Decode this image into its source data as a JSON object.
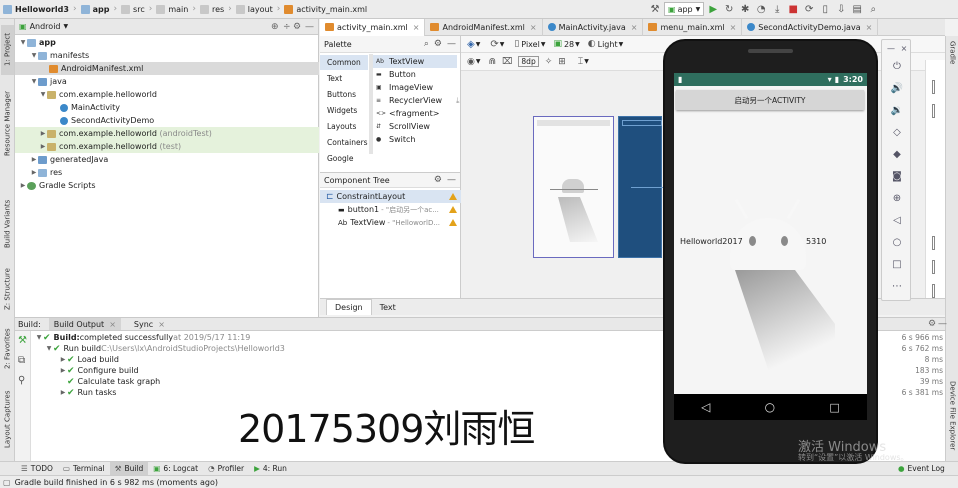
{
  "nav": {
    "crumbs": [
      "Helloworld3",
      "app",
      "src",
      "main",
      "res",
      "layout",
      "activity_main.xml"
    ],
    "run_config": "app"
  },
  "project": {
    "view_mode": "Android",
    "tree": [
      {
        "label": "app"
      },
      {
        "label": "manifests"
      },
      {
        "label": "AndroidManifest.xml"
      },
      {
        "label": "java"
      },
      {
        "label": "com.example.helloworld"
      },
      {
        "label": "MainActivity"
      },
      {
        "label": "SecondActivityDemo"
      },
      {
        "label": "com.example.helloworld",
        "suffix": "(androidTest)"
      },
      {
        "label": "com.example.helloworld",
        "suffix": "(test)"
      },
      {
        "label": "generatedJava"
      },
      {
        "label": "res"
      },
      {
        "label": "Gradle Scripts"
      }
    ]
  },
  "editor_tabs": [
    "activity_main.xml",
    "AndroidManifest.xml",
    "MainActivity.java",
    "menu_main.xml",
    "SecondActivityDemo.java"
  ],
  "palette": {
    "title": "Palette",
    "categories": [
      "Common",
      "Text",
      "Buttons",
      "Widgets",
      "Layouts",
      "Containers",
      "Google"
    ],
    "items": [
      "TextView",
      "Button",
      "ImageView",
      "RecyclerView",
      "<fragment>",
      "ScrollView",
      "Switch"
    ],
    "item_icons": [
      "Ab",
      "▬",
      "▣",
      "≡",
      "<>",
      "⇵",
      "●"
    ]
  },
  "design_toolbar": {
    "device": "Pixel",
    "api": "28",
    "theme": "Light",
    "margin": "8dp"
  },
  "component_tree": {
    "title": "Component Tree",
    "root": "ConstraintLayout",
    "items": [
      {
        "name": "button1",
        "detail": "- \"启动另一个ac..."
      },
      {
        "name": "TextView",
        "detail": "- \"HelloworlD..."
      }
    ]
  },
  "design_tabs": [
    "Design",
    "Text"
  ],
  "build": {
    "header_label": "Build:",
    "tabs": [
      "Build Output",
      "Sync"
    ],
    "lines": [
      {
        "text": "Build:",
        "text2": " completed successfully",
        "dim": " at 2019/5/17 11:19",
        "time": "6 s 966 ms"
      },
      {
        "text": "Run build",
        "dim": " C:\\Users\\lx\\AndroidStudioProjects\\Helloworld3",
        "time": "6 s 762 ms"
      },
      {
        "text": "Load build",
        "time": "8 ms"
      },
      {
        "text": "Configure build",
        "time": "183 ms"
      },
      {
        "text": "Calculate task graph",
        "time": "39 ms"
      },
      {
        "text": "Run tasks",
        "time": "6 s 381 ms"
      }
    ]
  },
  "bottom_tools": [
    "TODO",
    "Terminal",
    "Build",
    "6: Logcat",
    "Profiler",
    "4: Run"
  ],
  "event_log": "Event Log",
  "status": "Gradle build finished in 6 s 982 ms (moments ago)",
  "left_tabs": [
    "1: Project",
    "Resource Manager",
    "Build Variants",
    "Z: Structure",
    "2: Favorites",
    "Layout Captures"
  ],
  "right_tabs": [
    "Gradle",
    "Device File Explorer"
  ],
  "emulator": {
    "time": "3:20",
    "button_text": "启动另一个ACTIVITY",
    "hello_text": "Helloworld2017",
    "hello_suffix": "5310"
  },
  "overlay_text": "20175309刘雨恒",
  "watermark": "激活 Windows",
  "watermark2": "转到“设置”以激活 Windows。",
  "colors": {
    "check": "#3ca33c",
    "warning": "#e3a21a",
    "phone_status": "#2f6e5e",
    "selection": "#d9e4f2"
  }
}
